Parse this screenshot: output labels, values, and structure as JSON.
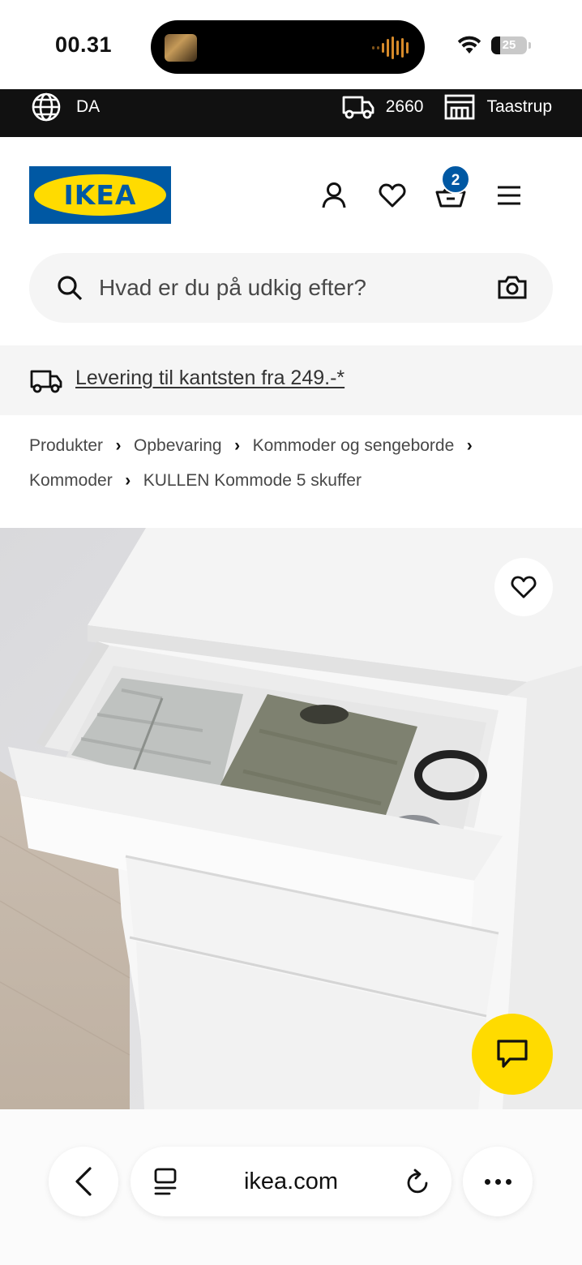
{
  "status_bar": {
    "time": "00.31",
    "battery": "25"
  },
  "top_bar": {
    "language": "DA",
    "postal_code": "2660",
    "store": "Taastrup"
  },
  "header": {
    "logo_text": "IKEA",
    "cart_count": "2"
  },
  "search": {
    "placeholder": "Hvad er du på udkig efter?"
  },
  "banner": {
    "text": "Levering til kantsten fra 249.-*"
  },
  "breadcrumb": {
    "items": [
      "Produkter",
      "Opbevaring",
      "Kommoder og sengeborde",
      "Kommoder",
      "KULLEN Kommode 5 skuffer"
    ]
  },
  "product": {
    "image_alt": "KULLEN Kommode 5 skuffer"
  },
  "browser": {
    "url": "ikea.com"
  },
  "colors": {
    "brand_blue": "#0058a3",
    "brand_yellow": "#ffdb00",
    "top_bar": "#111111"
  },
  "icons": [
    "globe-icon",
    "truck-icon",
    "store-icon",
    "account-icon",
    "heart-icon",
    "cart-icon",
    "menu-icon",
    "search-icon",
    "camera-icon",
    "chat-icon",
    "back-icon",
    "reader-icon",
    "reload-icon",
    "more-icon"
  ]
}
